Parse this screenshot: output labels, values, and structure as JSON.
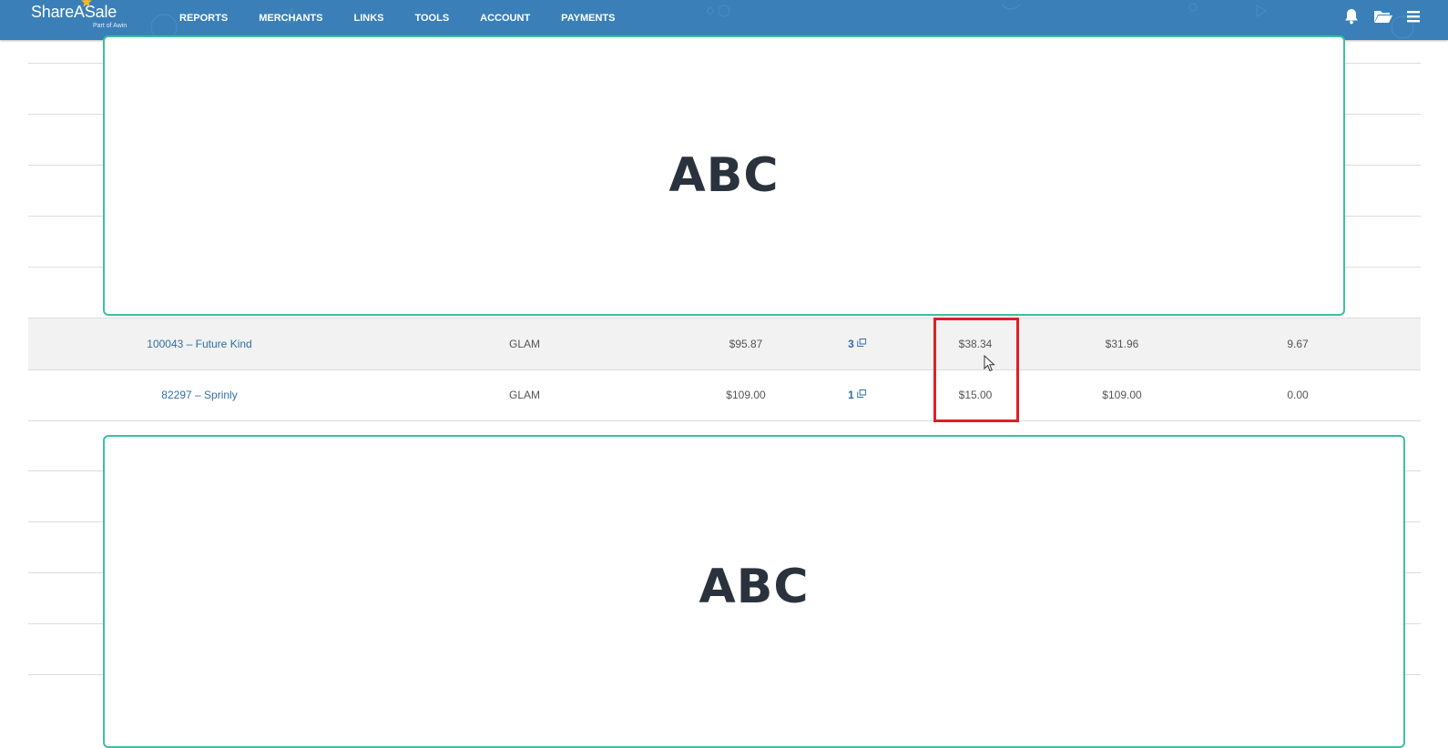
{
  "brand": {
    "name": "ShareASale",
    "tagline": "Part of Awin",
    "color": "#3a7fb8"
  },
  "nav": {
    "items": [
      "REPORTS",
      "MERCHANTS",
      "LINKS",
      "TOOLS",
      "ACCOUNT",
      "PAYMENTS"
    ]
  },
  "toolbar": {
    "icons": [
      "bell-icon",
      "folder-icon",
      "menu-icon"
    ]
  },
  "table": {
    "rows": [
      {
        "merchant": "100043 – Future Kind",
        "category": "GLAM",
        "sales": "$95.87",
        "count": "3",
        "highlighted_amount": "$38.34",
        "amount2": "$31.96",
        "value": "9.67"
      },
      {
        "merchant": "82297 – Sprinly",
        "category": "GLAM",
        "sales": "$109.00",
        "count": "1",
        "highlighted_amount": "$15.00",
        "amount2": "$109.00",
        "value": "0.00"
      }
    ]
  },
  "overlays": {
    "top_text": "ABC",
    "bottom_text": "ABC",
    "border_color": "#3fbf9d"
  },
  "highlight_color": "#e01e27"
}
